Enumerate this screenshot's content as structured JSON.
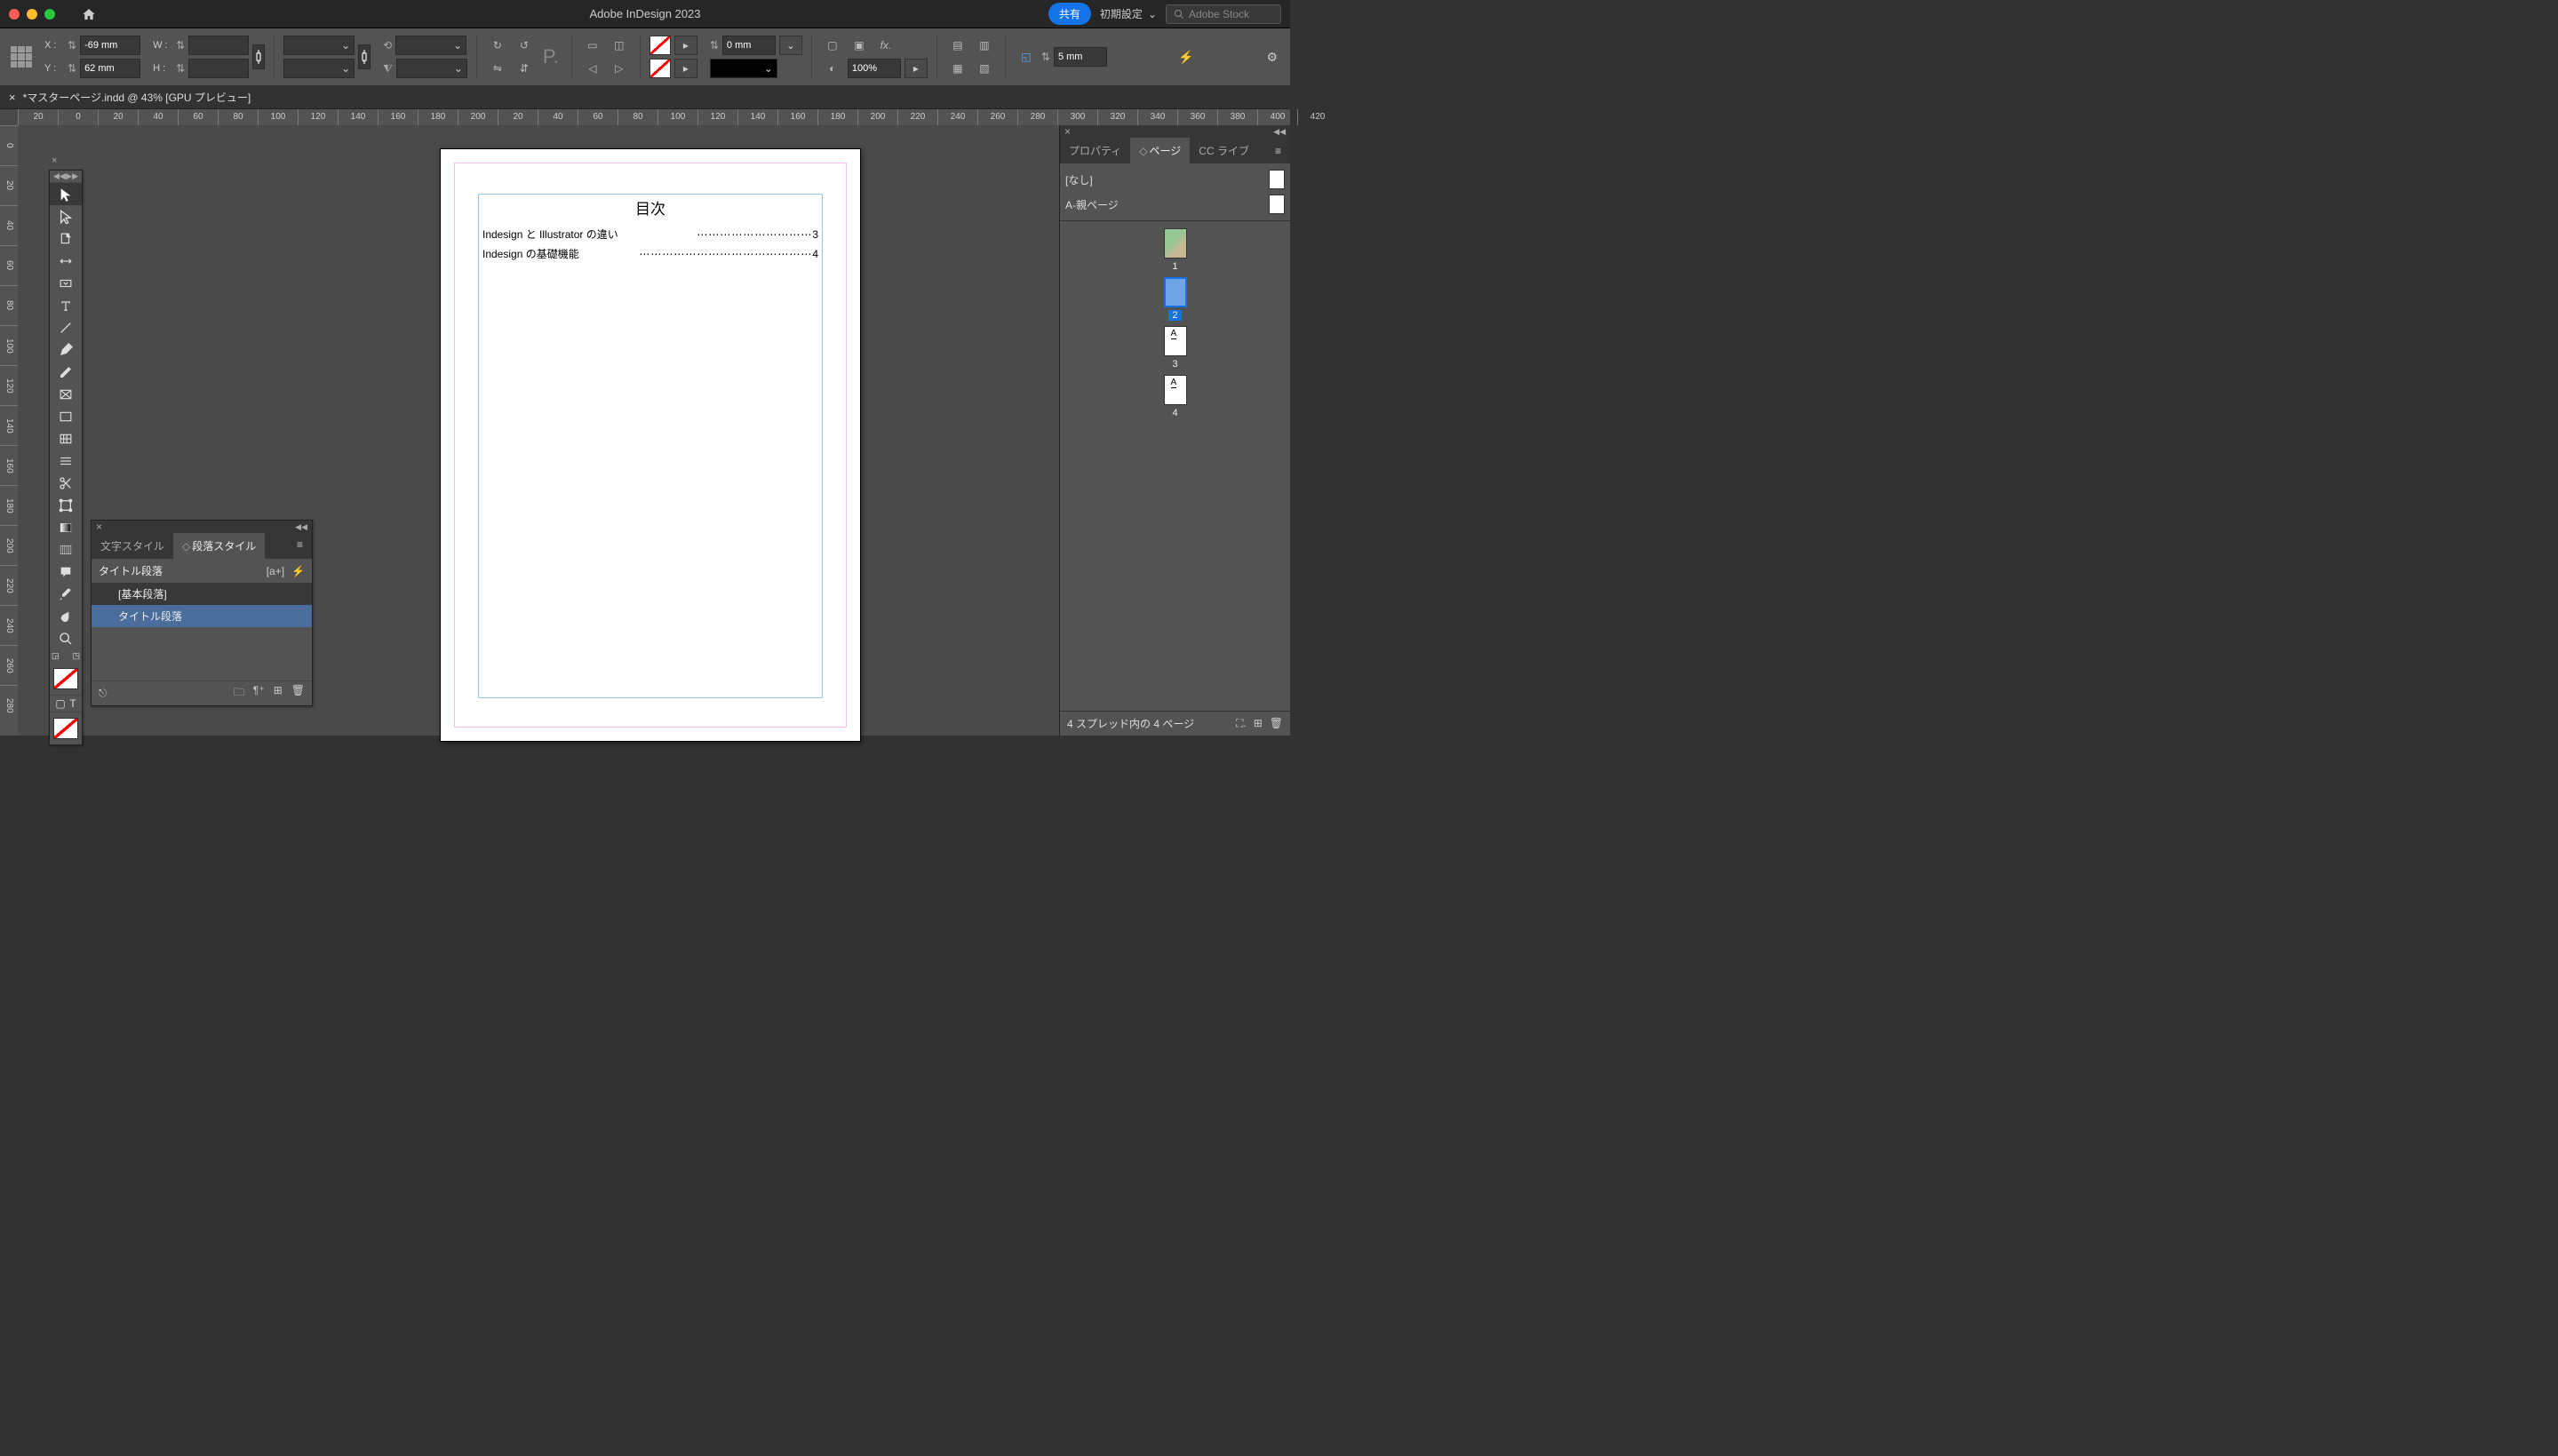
{
  "titlebar": {
    "app_title": "Adobe InDesign 2023",
    "share_label": "共有",
    "workspace_label": "初期設定",
    "stock_placeholder": "Adobe Stock"
  },
  "control_bar": {
    "x_label": "X :",
    "x_value": "-69 mm",
    "y_label": "Y :",
    "y_value": "62 mm",
    "w_label": "W :",
    "h_label": "H :",
    "stroke_value": "0 mm",
    "opacity_value": "100%",
    "corner_value": "5 mm"
  },
  "document_tab": {
    "label": "*マスターページ.indd @ 43% [GPU プレビュー]"
  },
  "ruler_h": [
    "20",
    "0",
    "20",
    "40",
    "60",
    "80",
    "100",
    "120",
    "140",
    "160",
    "180",
    "200",
    "20",
    "40",
    "60",
    "80",
    "100",
    "120",
    "140",
    "160",
    "180",
    "200",
    "220",
    "240",
    "260",
    "280",
    "300",
    "320",
    "340",
    "360",
    "380",
    "400",
    "420"
  ],
  "ruler_v": [
    "0",
    "20",
    "40",
    "60",
    "80",
    "100",
    "120",
    "140",
    "160",
    "180",
    "200",
    "220",
    "240",
    "260",
    "280"
  ],
  "page_content": {
    "title": "目次",
    "entries": [
      {
        "label": "Indesign と Illustrator の違い",
        "leader": "⋯⋯⋯⋯⋯⋯⋯⋯⋯⋯",
        "pg": "3"
      },
      {
        "label": "Indesign の基礎機能",
        "leader": "⋯⋯⋯⋯⋯⋯⋯⋯⋯⋯⋯⋯⋯⋯⋯",
        "pg": "4"
      }
    ]
  },
  "styles_panel": {
    "tab_char": "文字スタイル",
    "tab_para": "段落スタイル",
    "current_style": "タイトル段落",
    "items": [
      "[基本段落]",
      "タイトル段落"
    ]
  },
  "pages_panel": {
    "tab_prop": "プロパティ",
    "tab_pages": "ページ",
    "tab_cclib": "CC ライブ",
    "master_none": "[なし]",
    "master_a": "A-親ページ",
    "pages": [
      "1",
      "2",
      "3",
      "4"
    ],
    "footer_status": "4 スプレッド内の 4 ページ"
  }
}
